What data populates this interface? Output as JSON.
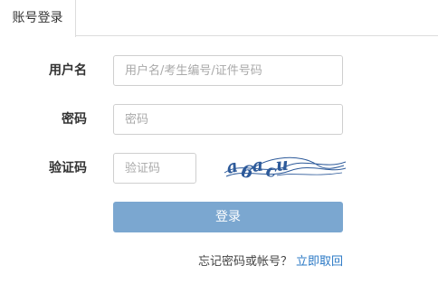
{
  "tabs": [
    {
      "label": "账号登录",
      "active": true
    }
  ],
  "form": {
    "username": {
      "label": "用户名",
      "placeholder": "用户名/考生编号/证件号码",
      "value": ""
    },
    "password": {
      "label": "密码",
      "placeholder": "密码",
      "value": ""
    },
    "captcha": {
      "label": "验证码",
      "placeholder": "验证码",
      "value": "",
      "image_text": "a6acu"
    }
  },
  "login_button": {
    "label": "登录"
  },
  "forgot": {
    "text": "忘记密码或帐号？",
    "link_label": "立即取回"
  },
  "colors": {
    "accent": "#7ba7d0",
    "link": "#2a78c5",
    "border": "#cfcfcf",
    "captcha_ink": "#2d5a9a"
  }
}
